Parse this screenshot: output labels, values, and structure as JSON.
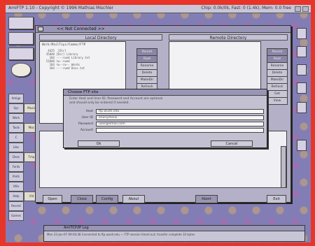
{
  "screen": {
    "title": "AmiFTP 1.10 - Copyright © 1996 Mathias Mischler",
    "status_right": "Chip: 0.0k/0k, Fast: 0 (1.4k), Mem: 0.0 free"
  },
  "desktop": {
    "sidebar_labels": [
      "Amiga",
      "Sys",
      "Work",
      "Tools",
      "C",
      "Libs",
      "Devs",
      "Fonts",
      "Prefs",
      "Utils",
      "Help",
      "Recent",
      "Games",
      "Music",
      "Misc",
      "Tmp",
      "Vid"
    ]
  },
  "main_window": {
    "title": "<< Not Connected >>",
    "local_header": "Local Directory",
    "remote_header": "Remote Directory",
    "local_path": "Work:MailToys/Comms/FTP",
    "local_listing": "   4425  [Dir]\n  35840 [Dir] Library\n    184 ----rwed Library.txt\n  51840 rw--rwed\n    184 rw--rw-- Words\n    184 ----rwed Docs.txt",
    "local_buttons": [
      "Parent",
      "Root",
      "Rename",
      "Delete",
      "MakeDir",
      "Refresh",
      "Add",
      "View"
    ],
    "remote_buttons": [
      "Parent",
      "Root",
      "Rename",
      "Delete",
      "MakeDir",
      "Refresh",
      "Get",
      "View"
    ],
    "bottom_buttons": {
      "open": "Open",
      "close": "Close",
      "config": "Config",
      "about": "About",
      "abort": "Abort",
      "exit": "Exit"
    }
  },
  "dialog": {
    "title": "Choose FTP site",
    "message": "Enter Host and User ID. Password and Account are optional\nand should only be entered if needed.",
    "fields": [
      {
        "label": "Host",
        "value": "ftp.wustl.edu"
      },
      {
        "label": "User ID",
        "value": "anonymous"
      },
      {
        "label": "Password",
        "value": "user@email.com"
      },
      {
        "label": "Account",
        "value": ""
      }
    ],
    "ok_label": "Ok",
    "cancel_label": "Cancel"
  },
  "log_window": {
    "title": "AmiTCP/IP Log",
    "lines": "Mon 23-Jun-97 09:04:38 Connected to ftp.wustl.edu — FTP session timed out; transfer complete 10 bytes"
  }
}
